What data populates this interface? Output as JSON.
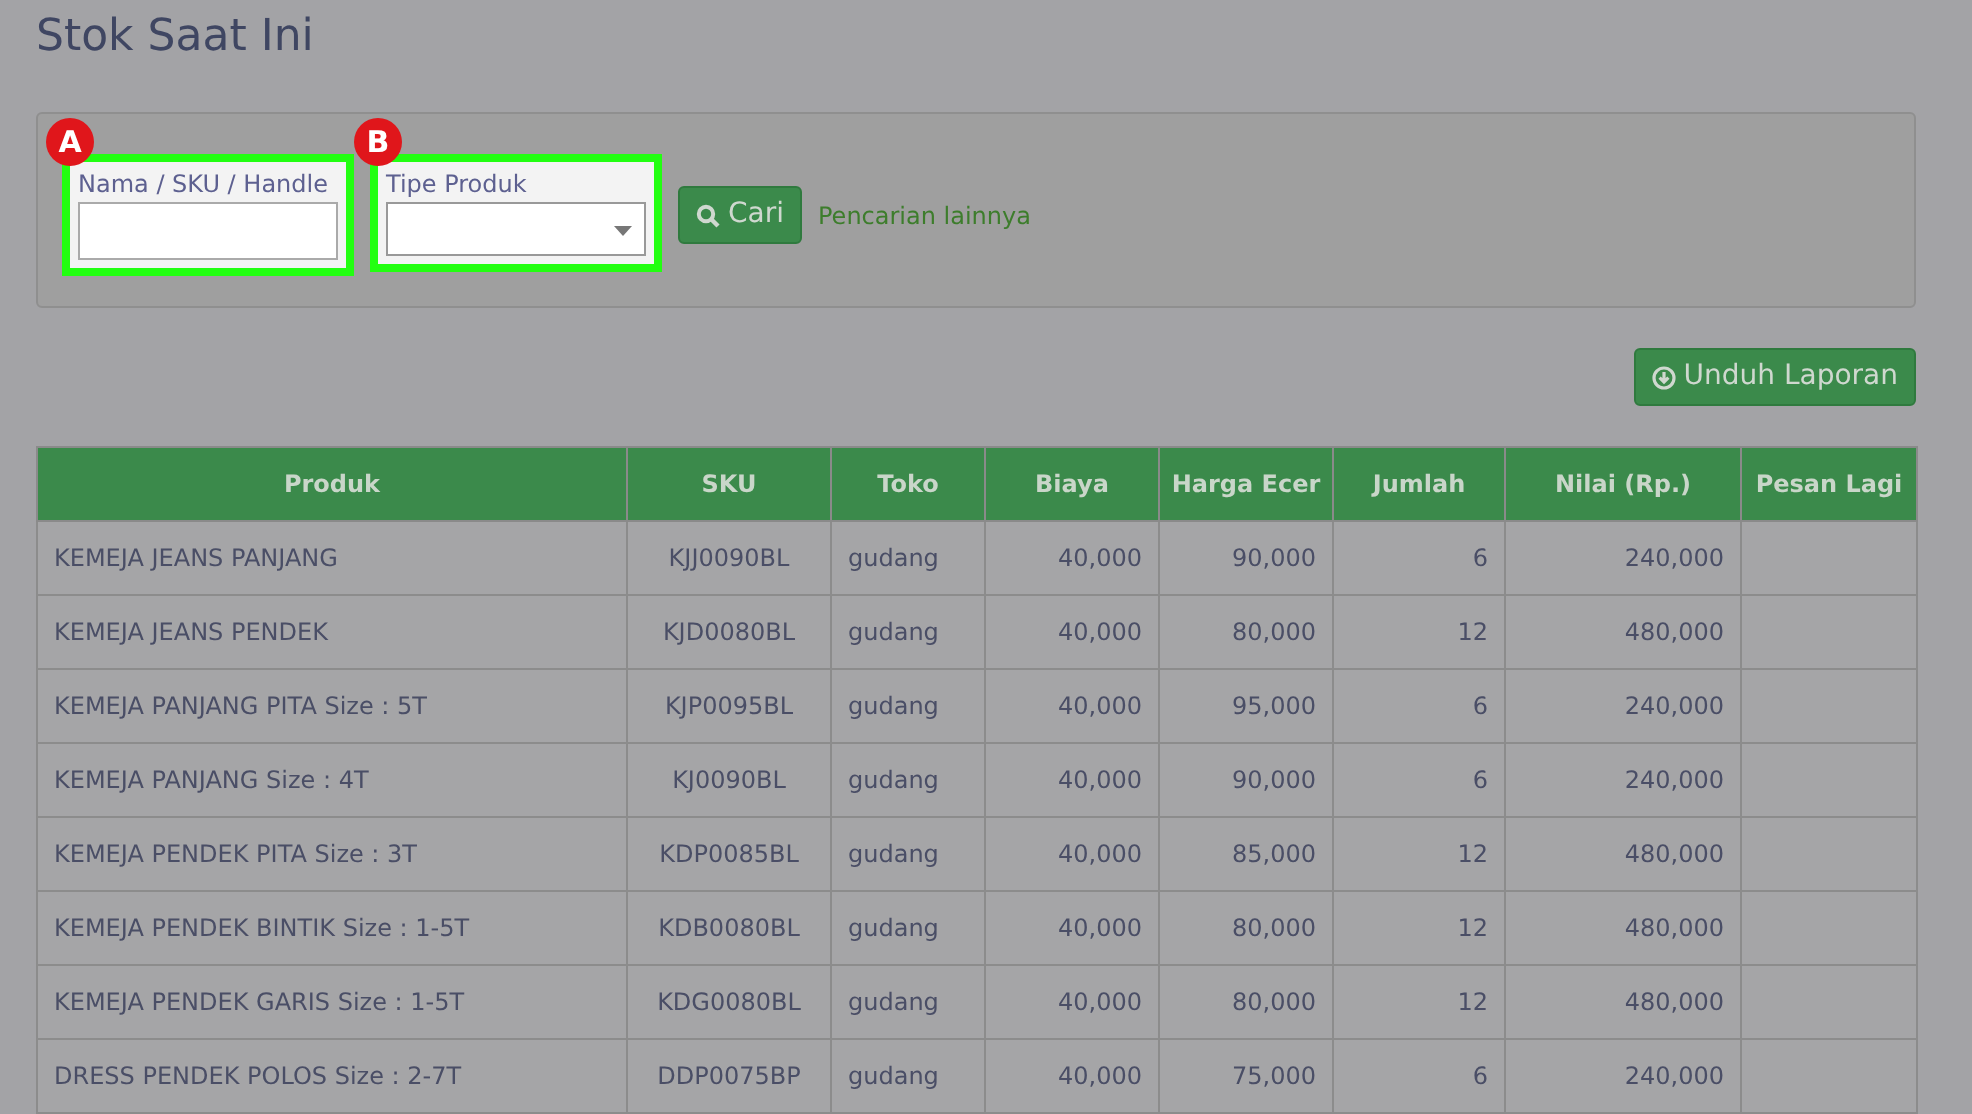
{
  "page_title": "Stok Saat Ini",
  "filters": [
    {
      "marker": "A",
      "label": "Nama / SKU / Handle",
      "kind": "text",
      "highlighted": true
    },
    {
      "marker": "B",
      "label": "Tipe Produk",
      "kind": "select",
      "highlighted": true
    }
  ],
  "search_button": "Cari",
  "more_search_link": "Pencarian lainnya",
  "download_button": "Unduh Laporan",
  "table": {
    "columns": [
      "Produk",
      "SKU",
      "Toko",
      "Biaya",
      "Harga Ecer",
      "Jumlah",
      "Nilai (Rp.)",
      "Pesan Lagi"
    ],
    "rows": [
      [
        "KEMEJA JEANS PANJANG",
        "KJJ0090BL",
        "gudang",
        "40,000",
        "90,000",
        "6",
        "240,000"
      ],
      [
        "KEMEJA JEANS PENDEK",
        "KJD0080BL",
        "gudang",
        "40,000",
        "80,000",
        "12",
        "480,000"
      ],
      [
        "KEMEJA PANJANG PITA Size : 5T",
        "KJP0095BL",
        "gudang",
        "40,000",
        "95,000",
        "6",
        "240,000"
      ],
      [
        "KEMEJA PANJANG Size : 4T",
        "KJ0090BL",
        "gudang",
        "40,000",
        "90,000",
        "6",
        "240,000"
      ],
      [
        "KEMEJA PENDEK PITA Size : 3T",
        "KDP0085BL",
        "gudang",
        "40,000",
        "85,000",
        "12",
        "480,000"
      ],
      [
        "KEMEJA PENDEK BINTIK Size : 1-5T",
        "KDB0080BL",
        "gudang",
        "40,000",
        "80,000",
        "12",
        "480,000"
      ],
      [
        "KEMEJA PENDEK GARIS Size : 1-5T",
        "KDG0080BL",
        "gudang",
        "40,000",
        "80,000",
        "12",
        "480,000"
      ],
      [
        "DRESS PENDEK POLOS Size : 2-7T",
        "DDP0075BP",
        "gudang",
        "40,000",
        "75,000",
        "6",
        "240,000"
      ]
    ]
  }
}
